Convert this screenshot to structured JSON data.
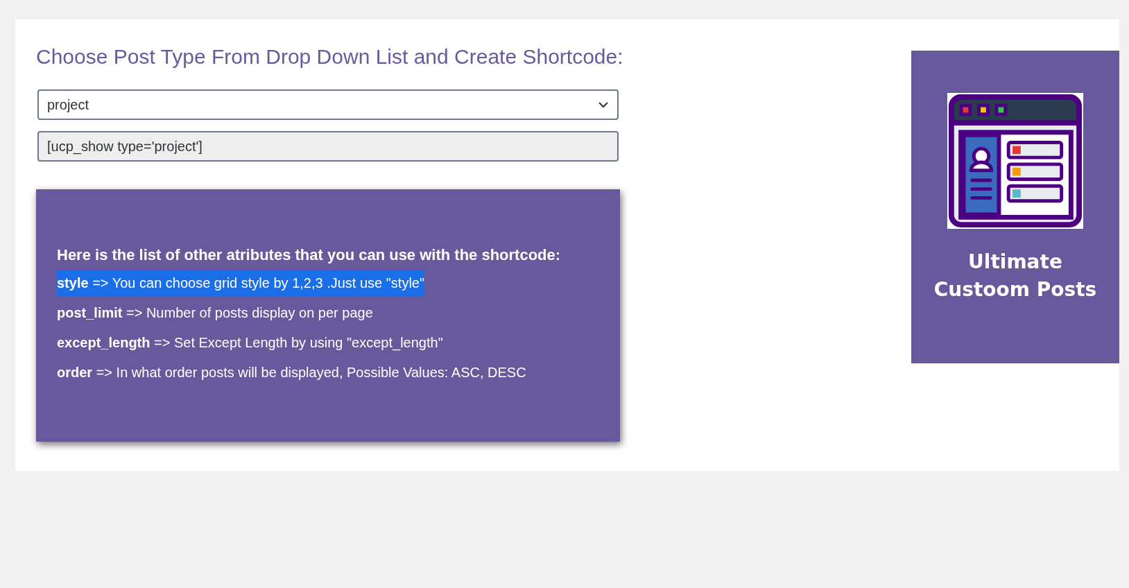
{
  "heading": "Choose Post Type From Drop Down List and Create Shortcode:",
  "post_type_select": {
    "value": "project"
  },
  "shortcode_field": {
    "value": "[ucp_show type='project']"
  },
  "attributes_panel": {
    "intro": "Here is the list of other atributes that you can use with the shortcode:",
    "items": [
      {
        "name": "style",
        "description": "=> You can choose grid style by 1,2,3 .Just use \"style\"",
        "selected": true
      },
      {
        "name": "post_limit",
        "description": "=> Number of posts display on per page",
        "selected": false
      },
      {
        "name": "except_length",
        "description": "=> Set Except Length by using \"except_length\"",
        "selected": false
      },
      {
        "name": "order",
        "description": "=> In what order posts will be displayed, Possible Values: ASC, DESC",
        "selected": false
      }
    ]
  },
  "promo_card": {
    "title_lines": [
      "Ultimate",
      "Custoom Posts"
    ]
  }
}
